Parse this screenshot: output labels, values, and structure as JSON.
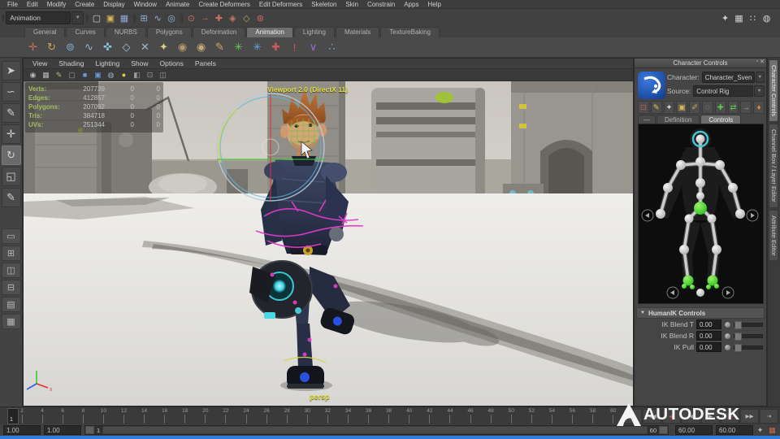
{
  "colors": {
    "hud_green": "#a4bd62",
    "viewport_label_yellow": "#e8e23c",
    "progress_blue": "#2e7fe0",
    "rig_magenta": "#e03ac8",
    "manip_cyan": "#57b8e0"
  },
  "menubar": {
    "items": [
      "File",
      "Edit",
      "Modify",
      "Create",
      "Display",
      "Window",
      "Animate",
      "Create Deformers",
      "Edit Deformers",
      "Skeleton",
      "Skin",
      "Constrain",
      "Apps",
      "Help"
    ]
  },
  "statusline": {
    "menuset": "Animation",
    "file_icons": [
      {
        "g": "▢",
        "c": "#d0d0d0"
      },
      {
        "g": "▣",
        "c": "#d8b455"
      },
      {
        "g": "▦",
        "c": "#8fa8d8"
      }
    ],
    "snap_icons": [
      {
        "g": "⊞",
        "c": "#8fb0d8"
      },
      {
        "g": "∿",
        "c": "#8fb0d8"
      },
      {
        "g": "◎",
        "c": "#8fb0d8"
      }
    ],
    "tool_icons": [
      {
        "g": "⊙",
        "c": "#c87060"
      },
      {
        "g": "→",
        "c": "#c87060"
      },
      {
        "g": "✚",
        "c": "#c87060"
      },
      {
        "g": "◈",
        "c": "#c87868"
      },
      {
        "g": "◇",
        "c": "#b8a060"
      },
      {
        "g": "⊛",
        "c": "#c87060"
      }
    ],
    "right_icons": [
      {
        "g": "✦",
        "c": "#cfcfcf"
      },
      {
        "g": "▦",
        "c": "#cfcfcf"
      },
      {
        "g": "∷",
        "c": "#cfcfcf"
      },
      {
        "g": "◍",
        "c": "#cfcfcf"
      }
    ]
  },
  "shelf": {
    "tabs": [
      {
        "label": "General"
      },
      {
        "label": "Curves"
      },
      {
        "label": "NURBS"
      },
      {
        "label": "Polygons"
      },
      {
        "label": "Deformation"
      },
      {
        "label": "Animation",
        "active": true
      },
      {
        "label": "Lighting"
      },
      {
        "label": "Materials"
      },
      {
        "label": "TextureBaking"
      }
    ],
    "icons": [
      {
        "g": "✛",
        "c": "#d06a5a"
      },
      {
        "g": "↻",
        "c": "#d0a05a"
      },
      {
        "g": "⊚",
        "c": "#7fb0d8"
      },
      {
        "g": "∿",
        "c": "#8ab8e0"
      },
      {
        "g": "✜",
        "c": "#86c8e8"
      },
      {
        "g": "◇",
        "c": "#a8c0d8"
      },
      {
        "g": "✕",
        "c": "#9fb8d0"
      },
      {
        "g": "✦",
        "c": "#d8d090"
      },
      {
        "g": "◉",
        "c": "#b89a6a"
      },
      {
        "g": "◉",
        "c": "#c8a87a"
      },
      {
        "g": "✎",
        "c": "#d8a060"
      },
      {
        "g": "✳",
        "c": "#68c858"
      },
      {
        "g": "✳",
        "c": "#5aa8e8"
      },
      {
        "g": "✚",
        "c": "#d05858"
      },
      {
        "g": "!",
        "c": "#d05858"
      },
      {
        "g": "∨",
        "c": "#9a6ad8"
      },
      {
        "g": "∴",
        "c": "#7ab0e0"
      }
    ]
  },
  "toolbox": {
    "tools": [
      {
        "name": "select-tool",
        "g": "➤"
      },
      {
        "name": "lasso-tool",
        "g": "∽"
      },
      {
        "name": "paint-select-tool",
        "g": "✎"
      },
      {
        "name": "move-tool",
        "g": "✛"
      },
      {
        "name": "rotate-tool",
        "g": "↻",
        "active": true
      },
      {
        "name": "scale-tool",
        "g": "◱"
      },
      {
        "name": "last-tool",
        "g": "✎"
      }
    ],
    "layouts": [
      {
        "g": "▭"
      },
      {
        "g": "⊞"
      },
      {
        "g": "◫"
      },
      {
        "g": "⊟"
      },
      {
        "g": "▤"
      },
      {
        "g": "▦"
      }
    ]
  },
  "viewport": {
    "menus": [
      "View",
      "Shading",
      "Lighting",
      "Show",
      "Options",
      "Panels"
    ],
    "toolbar_icons": [
      {
        "g": "◉",
        "c": "#b8b8b8"
      },
      {
        "g": "▦",
        "c": "#b8b8b8"
      },
      {
        "g": "✎",
        "c": "#a8c878"
      },
      {
        "g": "▢",
        "c": "#9a9a9a"
      },
      {
        "g": "■",
        "c": "#6898d8"
      },
      {
        "g": "▣",
        "c": "#6898d8"
      },
      {
        "g": "◍",
        "c": "#9ab0c8"
      },
      {
        "g": "●",
        "c": "#d8d048"
      },
      {
        "g": "◧",
        "c": "#9a9a9a"
      },
      {
        "g": "⊡",
        "c": "#9a9a9a"
      },
      {
        "g": "◫",
        "c": "#9a9a9a"
      }
    ],
    "renderer_label": "Viewport 2.0 (DirectX 11)",
    "camera_label": "persp",
    "axis": {
      "x": "x",
      "z": "z"
    },
    "hud": {
      "rows": [
        {
          "label": "Verts:",
          "value": "207739",
          "a": "0",
          "b": "0"
        },
        {
          "label": "Edges:",
          "value": "412857",
          "a": "0",
          "b": "0"
        },
        {
          "label": "Polygons:",
          "value": "207092",
          "a": "0",
          "b": "0"
        },
        {
          "label": "Tris:",
          "value": "384718",
          "a": "0",
          "b": "0"
        },
        {
          "label": "UVs:",
          "value": "251344",
          "a": "0",
          "b": "0"
        }
      ]
    }
  },
  "character_controls": {
    "title": "Character Controls",
    "character_label": "Character:",
    "character_value": "Character_Sven",
    "source_label": "Source:",
    "source_value": "Control Rig",
    "toolbar_icons": [
      {
        "g": "⊡",
        "c": "#c05858"
      },
      {
        "g": "✎",
        "c": "#d8c855"
      },
      {
        "g": "✦",
        "c": "#d8d8d8"
      },
      {
        "g": "▣",
        "c": "#d8b855"
      },
      {
        "g": "✐",
        "c": "#c8a860"
      },
      {
        "g": "◌",
        "c": "#9a9a9a"
      },
      {
        "g": "✚",
        "c": "#5ac84a"
      },
      {
        "g": "⇄",
        "c": "#5ac84a"
      },
      {
        "g": "→",
        "c": "#b8b8b8"
      },
      {
        "g": "♦",
        "c": "#d88a3a"
      }
    ],
    "tabs": [
      {
        "label": "Definition"
      },
      {
        "label": "Controls",
        "active": true
      }
    ],
    "humanik": {
      "title": "HumanIK Controls",
      "fields": [
        {
          "label": "IK Blend T",
          "value": "0.00"
        },
        {
          "label": "IK Blend R",
          "value": "0.00"
        },
        {
          "label": "IK Pull",
          "value": "0.00"
        }
      ]
    }
  },
  "right_tabs": [
    {
      "label": "Character Controls",
      "active": true
    },
    {
      "label": "Channel Box / Layer Editor"
    },
    {
      "label": "Attribute Editor"
    }
  ],
  "timeline": {
    "current_frame": "1",
    "ticks": [
      "2",
      "4",
      "6",
      "8",
      "10",
      "12",
      "14",
      "16",
      "18",
      "20",
      "22",
      "24",
      "26",
      "28",
      "30",
      "32",
      "34",
      "36",
      "38",
      "40",
      "42",
      "44",
      "46",
      "48",
      "50",
      "52",
      "54",
      "56",
      "58",
      "60"
    ]
  },
  "playback": {
    "buttons": [
      {
        "g": "⇤"
      },
      {
        "g": "◀◀"
      },
      {
        "g": "◀|",
        "red": true
      },
      {
        "g": "◀"
      },
      {
        "g": "▶"
      },
      {
        "g": "|▶",
        "red": true
      },
      {
        "g": "▶▶"
      },
      {
        "g": "⇥"
      }
    ]
  },
  "range_slider": {
    "anim_start": "1.00",
    "play_start": "1.00",
    "bar_start": "1",
    "bar_end": "60",
    "play_end": "60.00",
    "anim_end": "60.00"
  },
  "watermark": {
    "brand": "AUTODESK"
  }
}
